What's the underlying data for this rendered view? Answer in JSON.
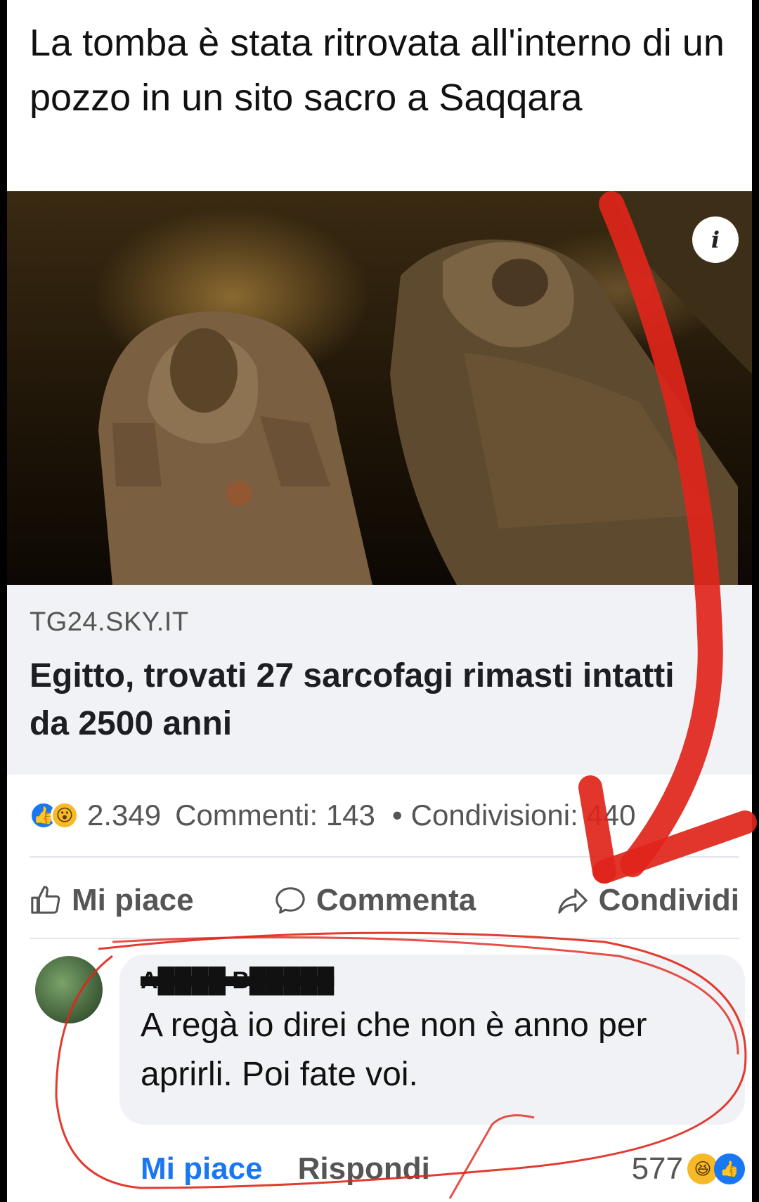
{
  "post": {
    "text": "La tomba è stata ritrovata all'interno di un pozzo in un sito sacro a Saqqara"
  },
  "link": {
    "domain": "TG24.SKY.IT",
    "headline": "Egitto, trovati 27 sarcofagi rimasti intatti da 2500 anni",
    "image_icon": "info-icon"
  },
  "stats": {
    "reactions_count": "2.349",
    "comments": "Commenti: 143",
    "separator": "•",
    "shares": "Condivisioni: 440",
    "reaction_icons": [
      "like-icon",
      "wow-icon"
    ]
  },
  "actions": {
    "like": "Mi piace",
    "comment": "Commenta",
    "share": "Condividi"
  },
  "comment": {
    "author": "A████ B█████",
    "text": "A regà io direi che non è anno per aprirli. Poi fate voi.",
    "like": "Mi piace",
    "reply": "Rispondi",
    "reaction_count": "577",
    "reaction_icons": [
      "haha-icon",
      "like-icon"
    ]
  },
  "colors": {
    "accent": "#1877f2",
    "annotation": "#e0251b"
  }
}
